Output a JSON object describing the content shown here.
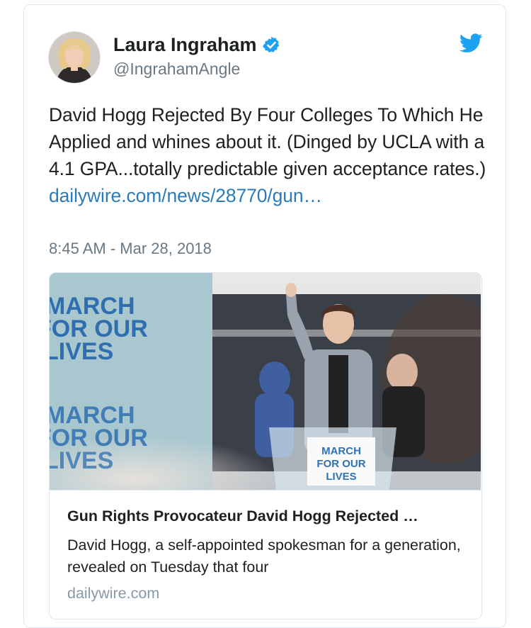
{
  "user": {
    "name": "Laura Ingraham",
    "handle": "@IngrahamAngle",
    "verified_icon": "verified-badge-icon",
    "avatar_icon": "avatar"
  },
  "tweet": {
    "text": "David Hogg Rejected By Four Colleges To Which He Applied and whines about it. (Dinged by UCLA with a 4.1 GPA...totally predictable given acceptance rates.)",
    "link": "dailywire.com/news/28770/gun…",
    "timestamp": "8:45 AM - Mar 28, 2018"
  },
  "card": {
    "title": "Gun Rights Provocateur David Hogg Rejected …",
    "description": "David Hogg, a self-appointed spokesman for a generation, revealed on Tuesday that four",
    "domain": "dailywire.com",
    "image": {
      "sign_line1": "MARCH",
      "sign_line2": "FOR OUR",
      "sign_line3": "LIVES"
    }
  },
  "colors": {
    "accent": "#1da1f2",
    "link": "#2b7bb9",
    "muted": "#697882",
    "border": "#e1e8ed"
  }
}
